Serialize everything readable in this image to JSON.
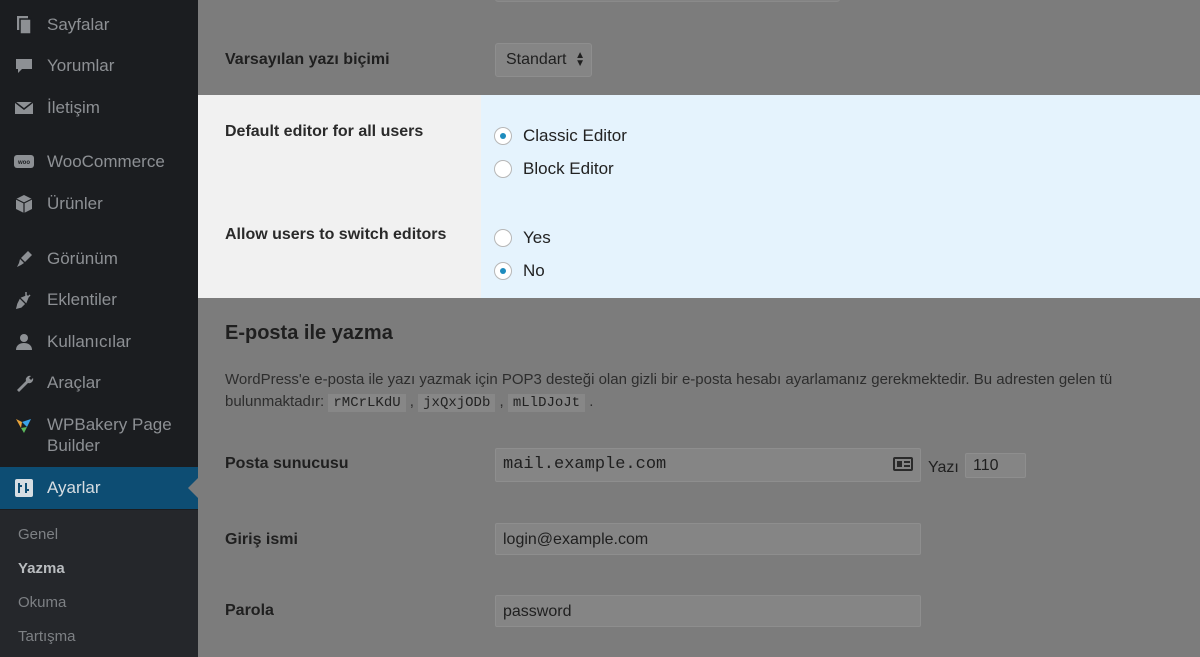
{
  "sidebar": {
    "items": [
      {
        "label": "Sayfalar",
        "icon": "pages-icon"
      },
      {
        "label": "Yorumlar",
        "icon": "comments-icon"
      },
      {
        "label": "İletişim",
        "icon": "mail-icon"
      },
      {
        "label": "WooCommerce",
        "icon": "woocommerce-icon"
      },
      {
        "label": "Ürünler",
        "icon": "products-icon"
      },
      {
        "label": "Görünüm",
        "icon": "appearance-icon"
      },
      {
        "label": "Eklentiler",
        "icon": "plugins-icon"
      },
      {
        "label": "Kullanıcılar",
        "icon": "users-icon"
      },
      {
        "label": "Araçlar",
        "icon": "tools-icon"
      },
      {
        "label": "WPBakery Page Builder",
        "icon": "wpbakery-icon"
      },
      {
        "label": "Ayarlar",
        "icon": "settings-icon"
      }
    ],
    "submenu": [
      "Genel",
      "Yazma",
      "Okuma",
      "Tartışma"
    ]
  },
  "main": {
    "default_format": {
      "label": "Varsayılan yazı biçimi",
      "value": "Standart"
    },
    "editor": {
      "default_label": "Default editor for all users",
      "options": [
        "Classic Editor",
        "Block Editor"
      ],
      "selected": "Classic Editor",
      "switch_label": "Allow users to switch editors",
      "switch_options": [
        "Yes",
        "No"
      ],
      "switch_selected": "No"
    },
    "email_section": {
      "title": "E-posta ile yazma",
      "desc_line1": "WordPress'e e-posta ile yazı yazmak için POP3 desteği olan gizli bir e-posta hesabı ayarlamanız gerekmektedir. Bu adresten gelen tü",
      "desc_line2_prefix": "bulunmaktadır:",
      "codes": [
        "rMCrLKdU",
        "jxQxjODb",
        "mLlDJoJt"
      ],
      "mail_server_label": "Posta sunucusu",
      "mail_server_value": "mail.example.com",
      "port_label": "Yazı",
      "port_value": "110",
      "login_label": "Giriş ismi",
      "login_value": "login@example.com",
      "password_label": "Parola",
      "password_value": "password"
    }
  },
  "colors": {
    "sidebar_bg": "#1b1d20",
    "active_bg": "#0d4d73",
    "highlight_bg": "#e5f3fd",
    "overlay_bg": "#7c7c7c",
    "radio_accent": "#1e8cbe"
  }
}
